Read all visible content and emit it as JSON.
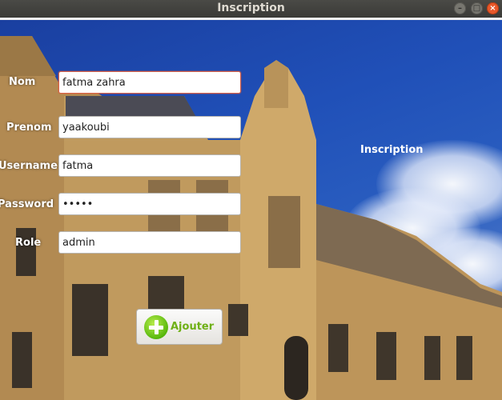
{
  "window": {
    "title": "Inscription",
    "minimize": "–",
    "maximize": "□",
    "close": "×"
  },
  "form": {
    "heading": "Inscription",
    "fields": [
      {
        "label": "Nom",
        "value": "fatma zahra"
      },
      {
        "label": "Prenom",
        "value": "yaakoubi"
      },
      {
        "label": "Username",
        "value": "fatma"
      },
      {
        "label": "Password",
        "value": "•••••"
      },
      {
        "label": "Role",
        "value": "admin"
      }
    ],
    "submit_label": "Ajouter"
  },
  "icons": {
    "submit": "plus-circle-icon"
  },
  "colors": {
    "accent": "#e9582a",
    "button_text": "#6fb016",
    "sky": "#2050b8"
  }
}
